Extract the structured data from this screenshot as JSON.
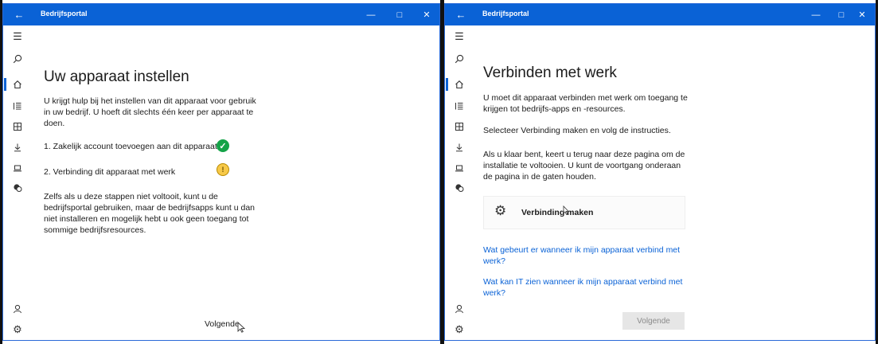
{
  "left_window": {
    "title": "Bedrijfsportal",
    "heading": "Uw apparaat instellen",
    "intro": "U krijgt hulp bij het instellen van dit apparaat voor gebruik in uw bedrijf. U hoeft dit slechts één keer per apparaat te doen.",
    "steps": [
      {
        "label": "1. Zakelijk account toevoegen aan dit apparaat",
        "status": "complete"
      },
      {
        "label": "2. Verbinding dit apparaat met werk",
        "status": "warning"
      }
    ],
    "note": "Zelfs als u deze stappen niet voltooit, kunt u de bedrijfsportal gebruiken, maar de bedrijfsapps kunt u dan niet installeren en mogelijk hebt u ook geen toegang tot sommige bedrijfsresources.",
    "next_label": "Volgende"
  },
  "right_window": {
    "title": "Bedrijfsportal",
    "heading": "Verbinden met werk",
    "para1": "U moet dit apparaat verbinden met werk om toegang te krijgen tot bedrijfs-apps en -resources.",
    "para2": "Selecteer Verbinding maken en volg de instructies.",
    "para3": "Als u klaar bent, keert u terug naar deze pagina om de installatie te voltooien. U kunt de voortgang onderaan de pagina in de gaten houden.",
    "connect_label": "Verbinding maken",
    "link1": "Wat gebeurt er wanneer ik mijn apparaat verbind met werk?",
    "link2": "Wat kan IT zien wanneer ik mijn apparaat verbind met werk?",
    "next_label": "Volgende"
  },
  "icons": {
    "back": "back-arrow-icon",
    "nav": [
      "hamburger-icon",
      "search-icon",
      "home-icon",
      "list-icon",
      "grid-icon",
      "download-icon",
      "laptop-icon",
      "chat-icon"
    ],
    "nav_bottom": [
      "person-icon",
      "gear-icon"
    ]
  },
  "colors": {
    "accent": "#0a62d6",
    "success": "#14a348",
    "warning": "#f7c948"
  }
}
